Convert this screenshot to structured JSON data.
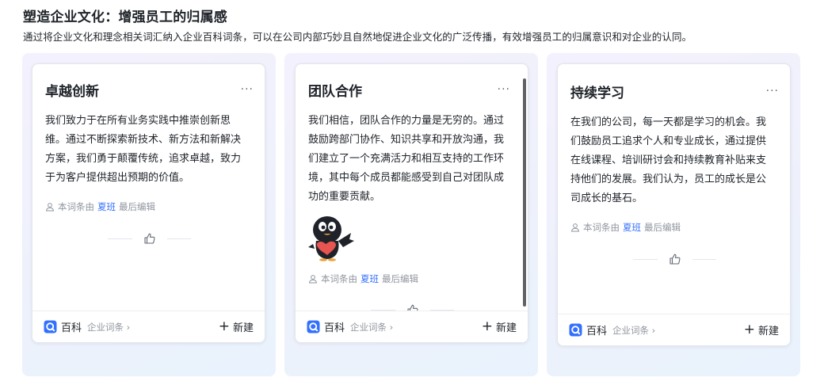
{
  "header": {
    "title": "塑造企业文化：增强员工的归属感",
    "subtitle": "通过将企业文化和理念相关词汇纳入企业百科词条，可以在公司内部巧妙且自然地促进企业文化的广泛传播，有效增强员工的归属意识和对企业的认同。"
  },
  "cards": [
    {
      "title": "卓越创新",
      "more": "···",
      "body": "我们致力于在所有业务实践中推崇创新思维。通过不断探索新技术、新方法和新解决方案，我们勇于颠覆传统，追求卓越，致力于为客户提供超出预期的价值。",
      "author_prefix": "本词条由",
      "author_name": "夏班",
      "author_suffix": "最后编辑",
      "brand": "百科",
      "brand_sub": "企业词条 ›",
      "new_label": "新建"
    },
    {
      "title": "团队合作",
      "more": "···",
      "body": "我们相信，团队合作的力量是无穷的。通过鼓励跨部门协作、知识共享和开放沟通，我们建立了一个充满活力和相互支持的工作环境，其中每个成员都能感受到自己对团队成功的重要贡献。",
      "author_prefix": "本词条由",
      "author_name": "夏班",
      "author_suffix": "最后编辑",
      "brand": "百科",
      "brand_sub": "企业词条 ›",
      "new_label": "新建"
    },
    {
      "title": "持续学习",
      "more": "···",
      "body": "在我们的公司，每一天都是学习的机会。我们鼓励员工追求个人和专业成长，通过提供在线课程、培训研讨会和持续教育补贴来支持他们的发展。我们认为，员工的成长是公司成长的基石。",
      "author_prefix": "本词条由",
      "author_name": "夏班",
      "author_suffix": "最后编辑",
      "brand": "百科",
      "brand_sub": "企业词条 ›",
      "new_label": "新建"
    }
  ],
  "colors": {
    "accent": "#3370ff",
    "muted": "#8f959e",
    "text": "#1f2329"
  },
  "icons": {
    "more": "more-icon",
    "author": "user-icon",
    "like": "thumbs-up-icon",
    "brand": "baike-logo-icon",
    "new": "plus-icon"
  }
}
